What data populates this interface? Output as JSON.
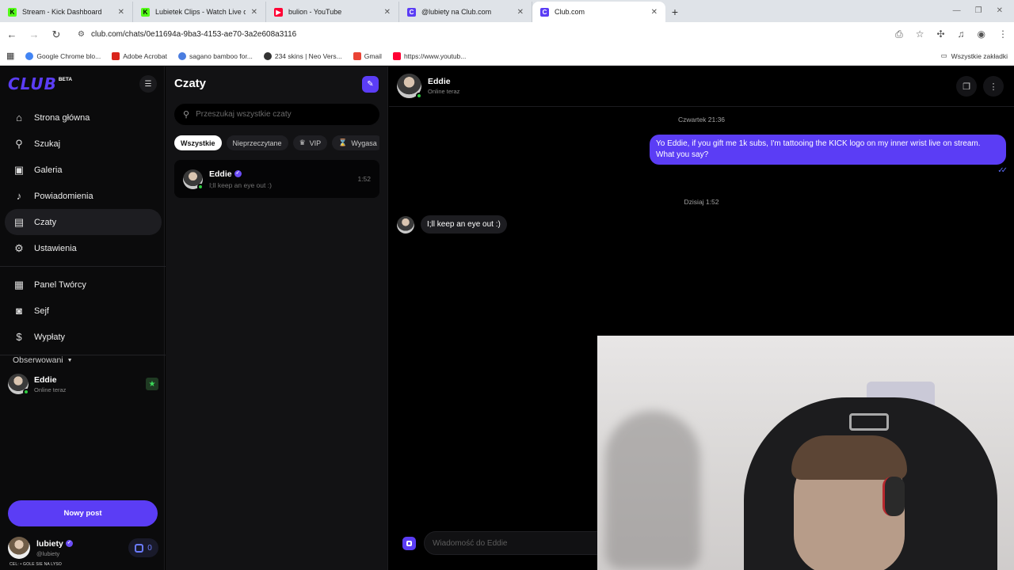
{
  "browser": {
    "tabs": [
      {
        "title": "Stream - Kick Dashboard",
        "favicon": "kick-icon",
        "color": "#53fc18",
        "active": false
      },
      {
        "title": "Lubietek Clips - Watch Live on Kick",
        "favicon": "kick-icon",
        "color": "#53fc18",
        "active": false
      },
      {
        "title": "bulion - YouTube",
        "favicon": "youtube-icon",
        "color": "#ff0033",
        "active": false
      },
      {
        "title": "@lubiety na Club.com",
        "favicon": "club-icon",
        "color": "#5b3df5",
        "active": false
      },
      {
        "title": "Club.com",
        "favicon": "club-icon",
        "color": "#5b3df5",
        "active": true
      }
    ],
    "url": "club.com/chats/0e11694a-9ba3-4153-ae70-3a2e608a3116",
    "bookmarks": [
      {
        "label": "Google Chrome blo...",
        "color": "#4285f4"
      },
      {
        "label": "Adobe Acrobat",
        "color": "#d9251c"
      },
      {
        "label": "sagano bamboo for...",
        "color": "#4a7de0"
      },
      {
        "label": "234 skins | Neo Vers...",
        "color": "#333333"
      },
      {
        "label": "Gmail",
        "color": "#ea4335"
      },
      {
        "label": "https://www.youtub...",
        "color": "#ff0033"
      }
    ],
    "bookmarks_all": "Wszystkie zakładki"
  },
  "sidebar": {
    "logo": "CLUB",
    "logo_badge": "BETA",
    "nav": [
      {
        "label": "Strona główna",
        "icon": "home-icon",
        "glyph": "⌂"
      },
      {
        "label": "Szukaj",
        "icon": "search-icon",
        "glyph": "⚲"
      },
      {
        "label": "Galeria",
        "icon": "gallery-icon",
        "glyph": "▣"
      },
      {
        "label": "Powiadomienia",
        "icon": "bell-icon",
        "glyph": "♪"
      },
      {
        "label": "Czaty",
        "icon": "chat-icon",
        "glyph": "▤"
      },
      {
        "label": "Ustawienia",
        "icon": "gear-icon",
        "glyph": "⚙"
      }
    ],
    "nav2": [
      {
        "label": "Panel Twórcy",
        "icon": "dashboard-icon",
        "glyph": "▦"
      },
      {
        "label": "Sejf",
        "icon": "vault-icon",
        "glyph": "◙"
      },
      {
        "label": "Wypłaty",
        "icon": "payout-icon",
        "glyph": "$"
      }
    ],
    "following_title": "Obserwowani",
    "following": {
      "name": "Eddie",
      "status": "Online teraz"
    },
    "new_post": "Nowy post",
    "user": {
      "name": "lubiety",
      "handle": "@lubiety",
      "coins": "0"
    },
    "overlay_text": "CEL: • GOLE SIE NA LYSO"
  },
  "chatlist": {
    "title": "Czaty",
    "search_placeholder": "Przeszukaj wszystkie czaty",
    "filters": [
      "Wszystkie",
      "Nieprzeczytane",
      "VIP",
      "Wygasa"
    ],
    "conversation": {
      "name": "Eddie",
      "preview": "I;ll keep an eye out :)",
      "time": "1:52"
    }
  },
  "conversation": {
    "name": "Eddie",
    "status": "Online teraz",
    "day1": "Czwartek 21:36",
    "outgoing": "Yo Eddie, if you gift me 1k subs, I'm tattooing the KICK logo on my inner wrist live on stream. What you say?",
    "day2": "Dzisiaj 1:52",
    "incoming": "I;ll keep an eye out :)",
    "composer_placeholder": "Wiadomość do Eddie"
  },
  "colors": {
    "accent": "#5b3df5",
    "online": "#2ecc40"
  }
}
